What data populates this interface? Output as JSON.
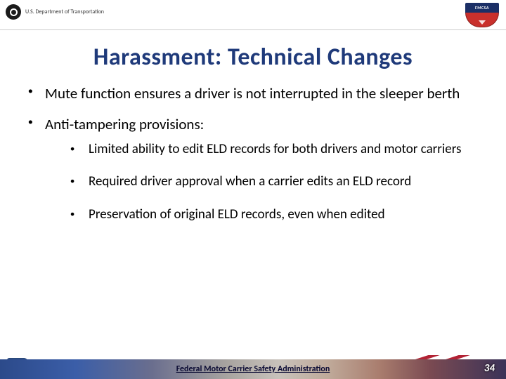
{
  "header": {
    "dept_label": "U.S. Department of Transportation",
    "badge_top": "FMCSA"
  },
  "slide": {
    "title": "Harassment: Technical Changes",
    "bullets": [
      {
        "text": "Mute function ensures a driver is not interrupted in the sleeper berth"
      },
      {
        "text": "Anti-tampering provisions:",
        "sub": [
          "Limited ability to edit ELD records for both drivers and motor carriers",
          "Required driver approval when a carrier edits an ELD record",
          "Preservation of original ELD records, even when edited"
        ]
      }
    ]
  },
  "footer": {
    "org": "Federal Motor Carrier Safety Administration",
    "page": "34"
  }
}
